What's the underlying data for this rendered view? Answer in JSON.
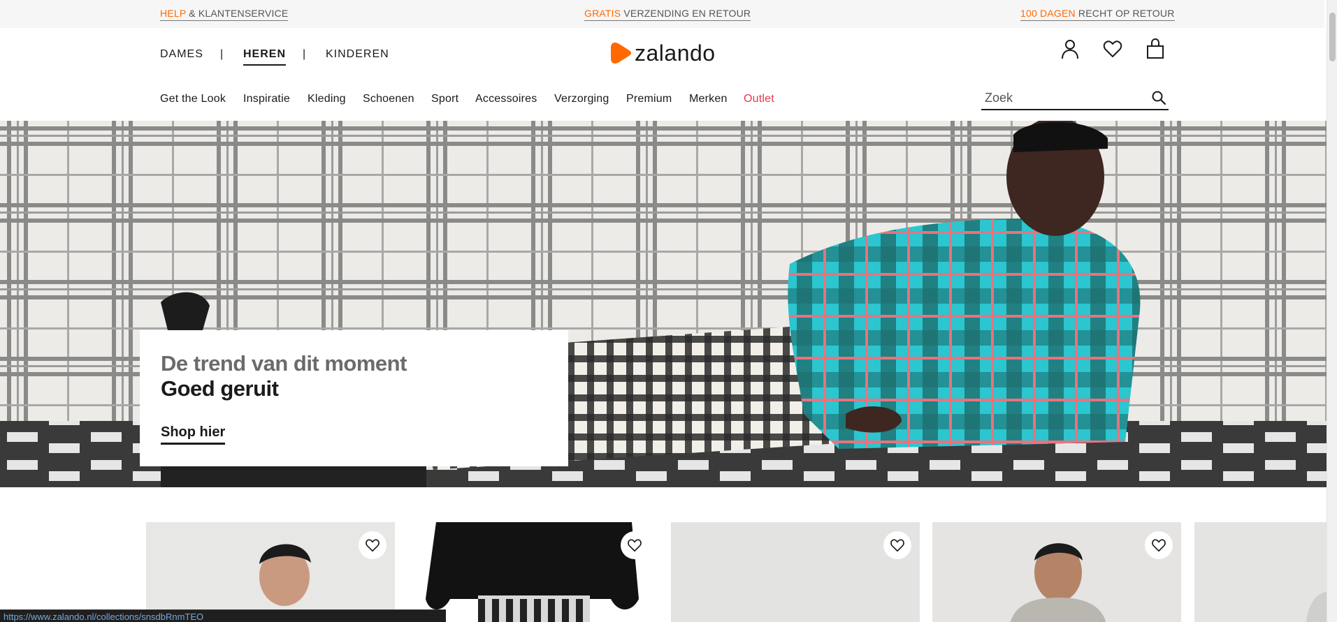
{
  "topbar": {
    "help": {
      "accent": "HELP",
      "rest": " & KLANTENSERVICE"
    },
    "shipping": {
      "accent": "GRATIS",
      "rest": " VERZENDING EN RETOUR"
    },
    "returns": {
      "accent": "100 DAGEN",
      "rest": " RECHT OP RETOUR"
    }
  },
  "genders": {
    "dames": "DAMES",
    "sep1": "|",
    "heren": "HEREN",
    "sep2": "|",
    "kinderen": "KINDEREN",
    "active": "HEREN"
  },
  "logo": {
    "text": "zalando",
    "mark_icon": "zalando-play-icon"
  },
  "header_icons": [
    "user-icon",
    "heart-icon",
    "bag-icon"
  ],
  "categories": [
    {
      "label": "Get the Look"
    },
    {
      "label": "Inspiratie"
    },
    {
      "label": "Kleding"
    },
    {
      "label": "Schoenen"
    },
    {
      "label": "Sport"
    },
    {
      "label": "Accessoires"
    },
    {
      "label": "Verzorging"
    },
    {
      "label": "Premium"
    },
    {
      "label": "Merken"
    },
    {
      "label": "Outlet"
    }
  ],
  "search": {
    "placeholder": "Zoek",
    "value": ""
  },
  "hero": {
    "subtitle": "De trend van dit moment",
    "title": "Goed geruit",
    "cta": "Shop hier"
  },
  "products_count_visible": 5,
  "status_url": "https://www.zalando.nl/collections/snsdbRnmTEO",
  "colors": {
    "brand_orange": "#ff6900",
    "outlet_red": "#e2384d",
    "text_dark": "#1a1a1a",
    "topbar_bg": "#f6f6f6"
  }
}
